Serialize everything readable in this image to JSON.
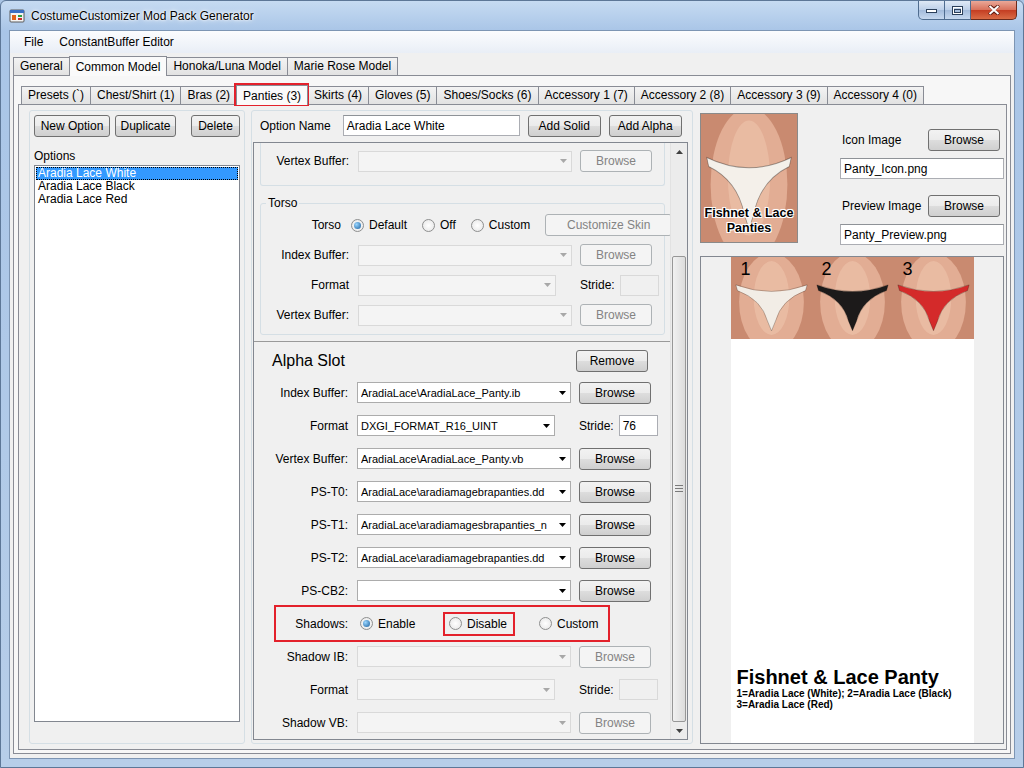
{
  "window": {
    "title": "CostumeCustomizer Mod Pack Generator"
  },
  "menu": [
    "File",
    "ConstantBuffer Editor"
  ],
  "main_tabs": [
    {
      "label": "General",
      "selected": false
    },
    {
      "label": "Common Model",
      "selected": true
    },
    {
      "label": "Honoka/Luna Model",
      "selected": false
    },
    {
      "label": "Marie Rose Model",
      "selected": false
    }
  ],
  "sub_tabs": [
    {
      "label": "Presets (`)",
      "selected": false,
      "highlighted": false
    },
    {
      "label": "Chest/Shirt (1)",
      "selected": false,
      "highlighted": false
    },
    {
      "label": "Bras (2)",
      "selected": false,
      "highlighted": false
    },
    {
      "label": "Panties (3)",
      "selected": true,
      "highlighted": true
    },
    {
      "label": "Skirts (4)",
      "selected": false,
      "highlighted": false
    },
    {
      "label": "Gloves (5)",
      "selected": false,
      "highlighted": false
    },
    {
      "label": "Shoes/Socks (6)",
      "selected": false,
      "highlighted": false
    },
    {
      "label": "Accessory 1 (7)",
      "selected": false,
      "highlighted": false
    },
    {
      "label": "Accessory 2 (8)",
      "selected": false,
      "highlighted": false
    },
    {
      "label": "Accessory 3 (9)",
      "selected": false,
      "highlighted": false
    },
    {
      "label": "Accessory 4 (0)",
      "selected": false,
      "highlighted": false
    }
  ],
  "options_panel": {
    "buttons": [
      "New Option",
      "Duplicate",
      "Delete"
    ],
    "label": "Options",
    "items": [
      {
        "label": "Aradia Lace White",
        "selected": true
      },
      {
        "label": "Aradia Lace Black",
        "selected": false
      },
      {
        "label": "Aradia Lace Red",
        "selected": false
      }
    ]
  },
  "editor": {
    "option_name": {
      "label": "Option Name",
      "value": "Aradia Lace White"
    },
    "buttons": [
      "Add Solid",
      "Add Alpha"
    ],
    "cut_group": {
      "rows": [
        {
          "kind": "file",
          "label": "Vertex Buffer:",
          "value": "",
          "button": "Browse",
          "disabled": true
        }
      ]
    },
    "torso": {
      "title": "Torso",
      "rows": [
        {
          "kind": "radio",
          "label": "Torso",
          "highlighted": false,
          "options": [
            {
              "label": "Default",
              "selected": true,
              "highlighted": false
            },
            {
              "label": "Off",
              "selected": false,
              "highlighted": false
            },
            {
              "label": "Custom",
              "selected": false,
              "highlighted": false
            }
          ],
          "button": {
            "label": "Customize Skin",
            "disabled": true
          }
        },
        {
          "kind": "file",
          "label": "Index Buffer:",
          "value": "",
          "button": "Browse",
          "disabled": true
        },
        {
          "kind": "format",
          "label": "Format",
          "value": "",
          "stride_label": "Stride:",
          "stride": "",
          "disabled": true
        },
        {
          "kind": "file",
          "label": "Vertex Buffer:",
          "value": "",
          "button": "Browse",
          "disabled": true
        }
      ]
    },
    "alpha_slot": {
      "title": "Alpha Slot",
      "button": "Remove",
      "rows": [
        {
          "kind": "file",
          "label": "Index Buffer:",
          "value": "AradiaLace\\AradiaLace_Panty.ib",
          "button": "Browse",
          "disabled": false
        },
        {
          "kind": "format",
          "label": "Format",
          "value": "DXGI_FORMAT_R16_UINT",
          "stride_label": "Stride:",
          "stride": "76",
          "disabled": false
        },
        {
          "kind": "file",
          "label": "Vertex Buffer:",
          "value": "AradiaLace\\AradiaLace_Panty.vb",
          "button": "Browse",
          "disabled": false
        },
        {
          "kind": "file",
          "label": "PS-T0:",
          "value": "AradiaLace\\aradiamagebrapanties.dd",
          "button": "Browse",
          "disabled": false
        },
        {
          "kind": "file",
          "label": "PS-T1:",
          "value": "AradiaLace\\aradiamagesbrapanties_n",
          "button": "Browse",
          "disabled": false
        },
        {
          "kind": "file",
          "label": "PS-T2:",
          "value": "AradiaLace\\aradiamagebrapanties.dd",
          "button": "Browse",
          "disabled": false
        },
        {
          "kind": "file",
          "label": "PS-CB2:",
          "value": "",
          "button": "Browse",
          "disabled": false
        },
        {
          "kind": "radio",
          "label": "Shadows:",
          "highlighted": true,
          "options": [
            {
              "label": "Enable",
              "selected": true,
              "highlighted": false
            },
            {
              "label": "Disable",
              "selected": false,
              "highlighted": true
            },
            {
              "label": "Custom",
              "selected": false,
              "highlighted": false
            }
          ]
        },
        {
          "kind": "file",
          "label": "Shadow IB:",
          "value": "",
          "button": "Browse",
          "disabled": true
        },
        {
          "kind": "format",
          "label": "Format",
          "value": "",
          "stride_label": "Stride:",
          "stride": "",
          "disabled": true
        },
        {
          "kind": "file",
          "label": "Shadow VB:",
          "value": "",
          "button": "Browse",
          "disabled": true
        }
      ]
    },
    "scrollbar": {
      "level": 1
    }
  },
  "preview_panel": {
    "icon_image": {
      "label": "Icon Image",
      "button": "Browse",
      "file": "Panty_Icon.png",
      "caption": "Fishnet & Lace Panties"
    },
    "preview_image": {
      "label": "Preview Image",
      "button": "Browse",
      "file": "Panty_Preview.png",
      "swatches": [
        {
          "number": "1",
          "color": "#f2ede6"
        },
        {
          "number": "2",
          "color": "#1c1a1a"
        },
        {
          "number": "3",
          "color": "#d42a2a"
        }
      ],
      "title": "Fishnet & Lace Panty",
      "legend": [
        "1=Aradia Lace (White); 2=Aradia Lace (Black)",
        "3=Aradia Lace (Red)"
      ]
    }
  }
}
